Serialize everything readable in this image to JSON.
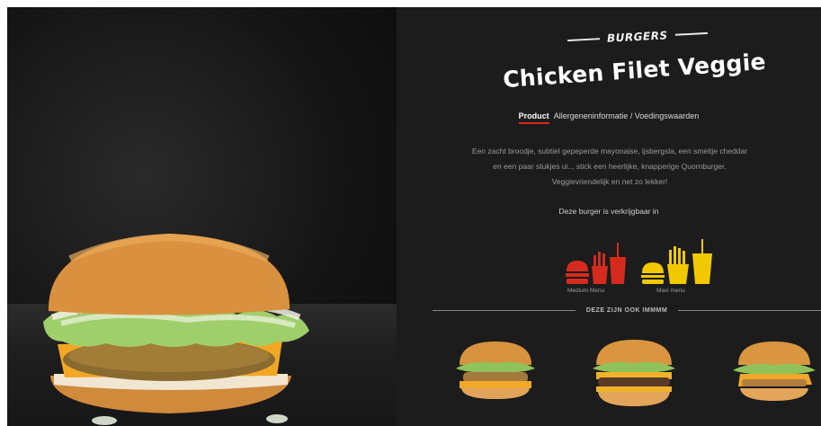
{
  "product": {
    "category": "BURGERS",
    "title": "Chicken Filet Veggie",
    "tabs": [
      {
        "label": "Product",
        "active": true
      },
      {
        "label": "Allergeneninformatie / Voedingswaarden",
        "active": false
      }
    ],
    "description": "Een zacht broodje, subtiel gepeperde mayonaise, ijsbergsla, een smeltje cheddar en een paar stukjes ui... stick een heerlijke, knapperige Quornburger. Veggievriendelijk en net zo lekker!",
    "availability_text": "Deze burger is verkrijgbaar in"
  },
  "menus": [
    {
      "label": "Medium Menu",
      "color": "#d52b1e",
      "icon": "burger-fries-drink-icon"
    },
    {
      "label": "Maxi menu",
      "color": "#f2c800",
      "icon": "burger-fries-drink-icon"
    }
  ],
  "related": {
    "heading": "DEZE ZIJN OOK IMMMM",
    "items": [
      {
        "name": "",
        "icon": "chicken-burger-image"
      },
      {
        "name": "",
        "icon": "double-burger-image"
      },
      {
        "name": "",
        "icon": "cheese-burger-image"
      }
    ]
  },
  "colors": {
    "accent_red": "#d52b1e",
    "accent_yellow": "#f2c800",
    "panel_bg": "#1c1c1c"
  }
}
